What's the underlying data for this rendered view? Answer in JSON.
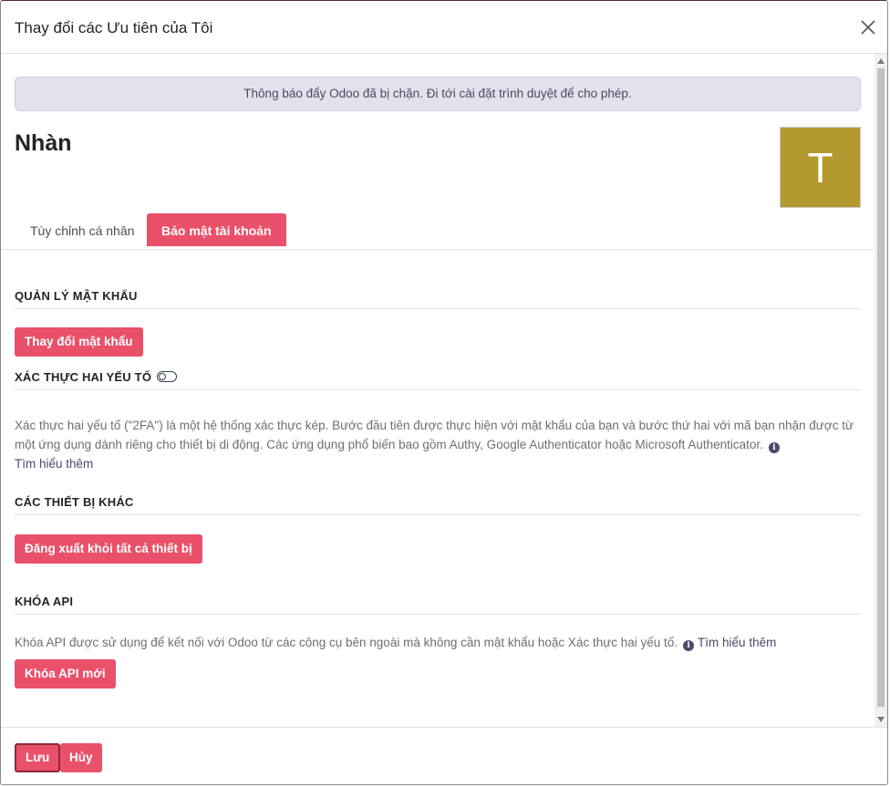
{
  "dialog": {
    "title": "Thay đổi các Ưu tiên của Tôi",
    "close_icon": "close-icon"
  },
  "alert": {
    "text": "Thông báo đẩy Odoo đã bị chặn. Đi tới cài đặt trình duyệt để cho phép."
  },
  "user": {
    "name": "Nhàn",
    "avatar_letter": "T",
    "avatar_color": "#b39a2e"
  },
  "tabs": [
    {
      "label": "Tùy chỉnh cá nhân",
      "active": false
    },
    {
      "label": "Bảo mật tài khoản",
      "active": true
    }
  ],
  "sections": {
    "password": {
      "title": "QUẢN LÝ MẬT KHẨU",
      "button": "Thay đổi mật khẩu"
    },
    "twofa": {
      "title": "XÁC THỰC HAI YẾU TỐ",
      "enabled": false,
      "description": "Xác thực hai yếu tố (\"2FA\") là một hệ thống xác thực kép. Bước đầu tiên được thực hiện với mật khẩu của bạn và bước thứ hai với mã bạn nhận được từ một ứng dụng dành riêng cho thiết bị di động. Các ứng dụng phổ biến bao gồm Authy, Google Authenticator hoặc Microsoft Authenticator.",
      "learn_more": "Tìm hiểu thêm"
    },
    "devices": {
      "title": "CÁC THIẾT BỊ KHÁC",
      "button": "Đăng xuất khỏi tất cả thiết bị"
    },
    "api": {
      "title": "KHÓA API",
      "description": "Khóa API được sử dụng để kết nối với Odoo từ các công cụ bên ngoài mà không cần mật khẩu hoặc Xác thực hai yếu tố.",
      "learn_more": "Tìm hiểu thêm",
      "button": "Khóa API mới"
    }
  },
  "footer": {
    "save": "Lưu",
    "cancel": "Hủy"
  },
  "colors": {
    "accent": "#e9516a",
    "alert_bg": "#e4e1ee"
  }
}
